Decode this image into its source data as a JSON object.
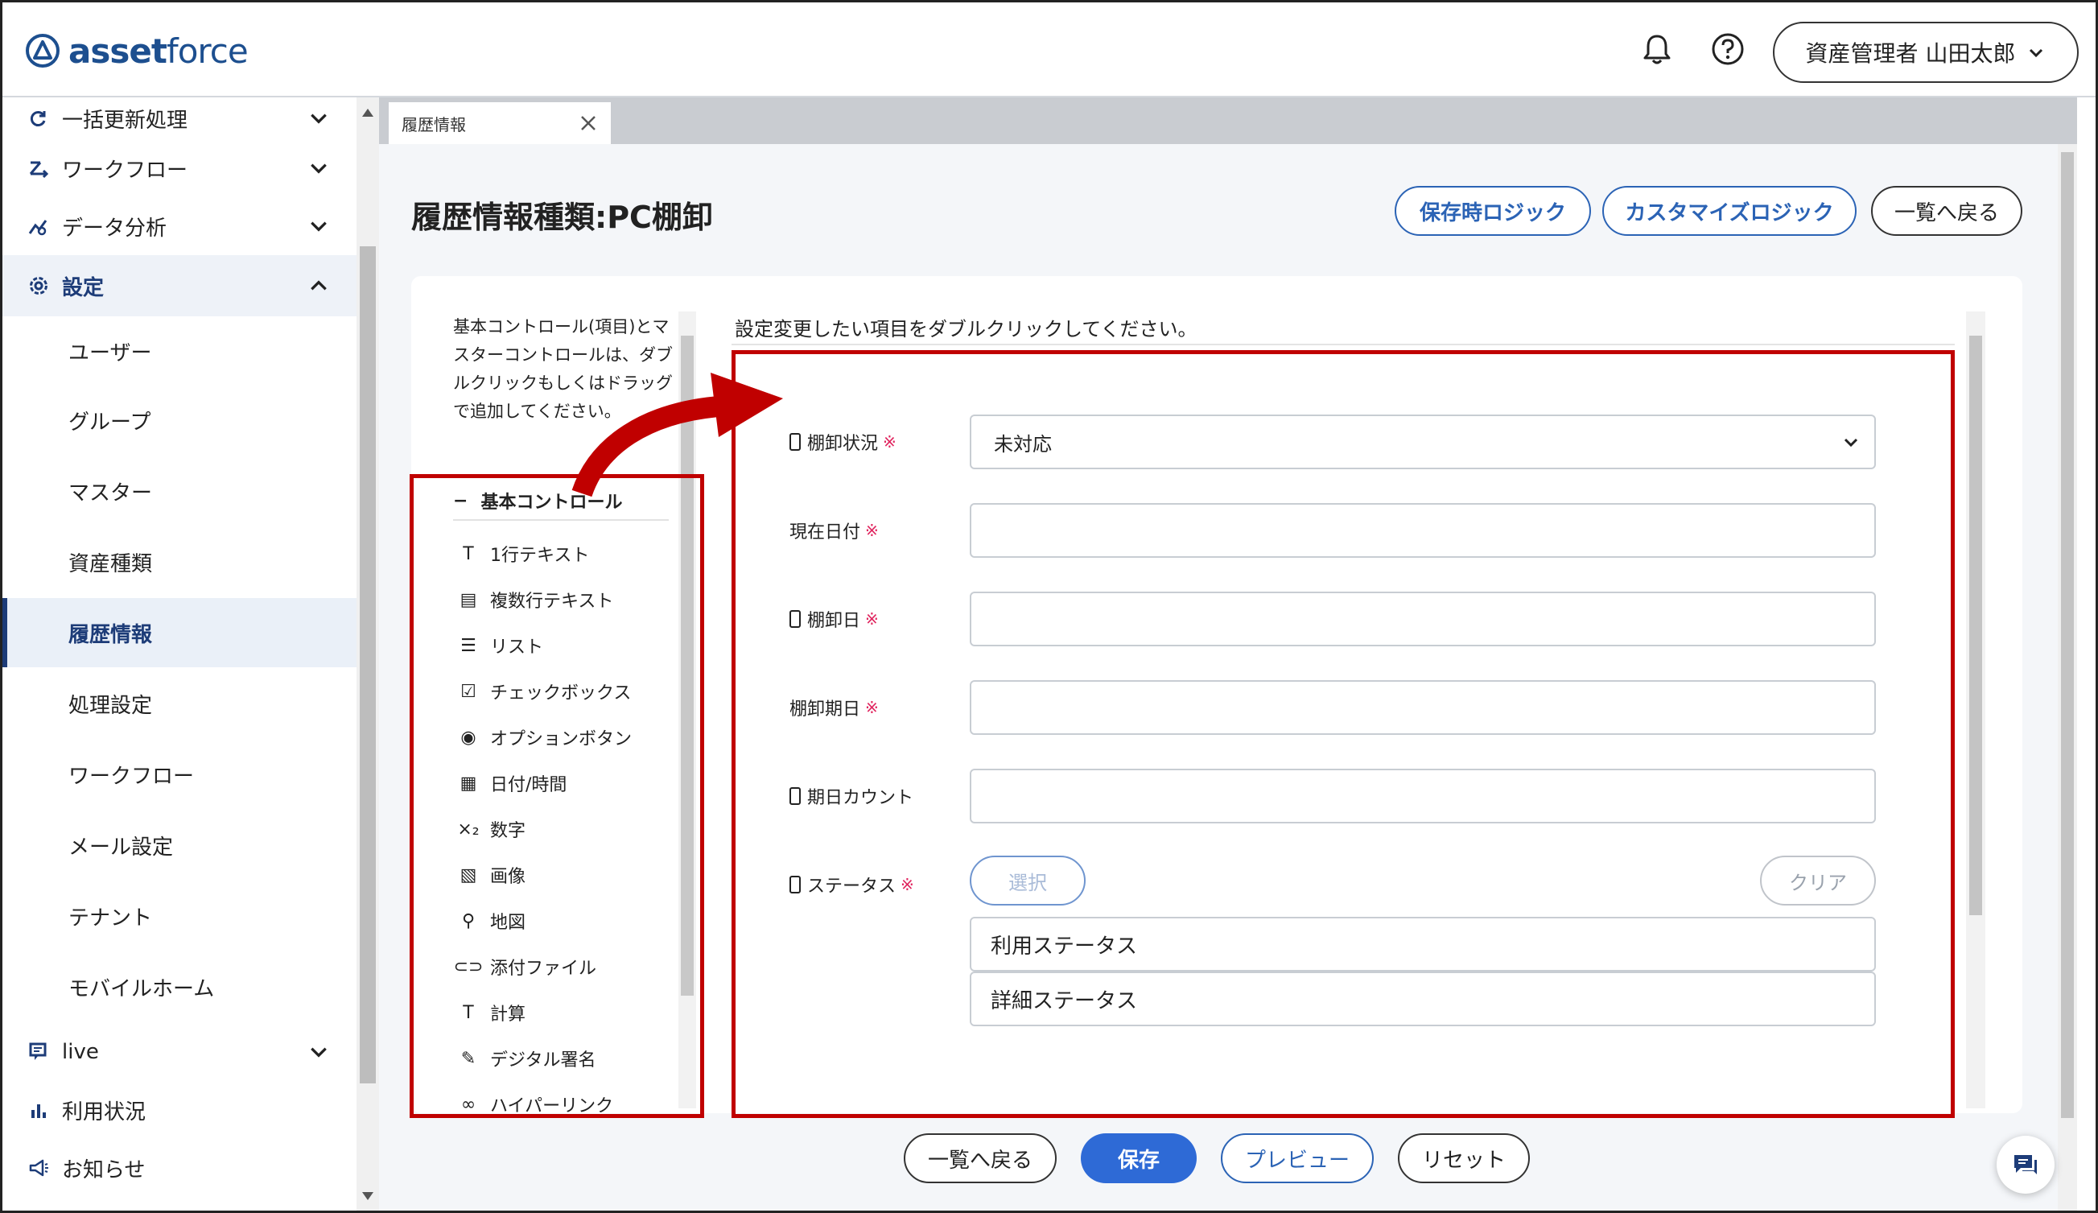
{
  "header": {
    "logo_bold": "asset",
    "logo_thin": "force",
    "user_label": "資産管理者 山田太郎",
    "icons": [
      "bell-icon",
      "help-icon"
    ]
  },
  "sidebar": {
    "items_top": [
      {
        "label": "一括更新処理",
        "icon": "refresh-icon"
      },
      {
        "label": "ワークフロー",
        "icon": "workflow-icon"
      },
      {
        "label": "データ分析",
        "icon": "analytics-icon"
      },
      {
        "label": "設定",
        "icon": "gear-icon"
      }
    ],
    "sub_items": [
      "ユーザー",
      "グループ",
      "マスター",
      "資産種類",
      "履歴情報",
      "処理設定",
      "ワークフロー",
      "メール設定",
      "テナント",
      "モバイルホーム"
    ],
    "active_sub": "履歴情報",
    "items_bottom": [
      {
        "label": "live",
        "icon": "live-icon"
      },
      {
        "label": "利用状況",
        "icon": "bar-chart-icon"
      },
      {
        "label": "お知らせ",
        "icon": "megaphone-icon"
      }
    ]
  },
  "tab": {
    "label": "履歴情報"
  },
  "page": {
    "title": "履歴情報種類:PC棚卸",
    "btn_save_logic": "保存時ロジック",
    "btn_custom_logic": "カスタマイズロジック",
    "btn_back_list": "一覧へ戻る"
  },
  "palette": {
    "intro": "基本コントロール(項目)とマスターコントロールは、ダブルクリックもしくはドラッグで追加してください。",
    "section_title": "基本コントロール",
    "section_toggle": "−",
    "items": [
      {
        "label": "1行テキスト",
        "icon": "T"
      },
      {
        "label": "複数行テキスト",
        "icon": "▤"
      },
      {
        "label": "リスト",
        "icon": "☰"
      },
      {
        "label": "チェックボックス",
        "icon": "☑"
      },
      {
        "label": "オプションボタン",
        "icon": "◉"
      },
      {
        "label": "日付/時間",
        "icon": "▦"
      },
      {
        "label": "数字",
        "icon": "×₂"
      },
      {
        "label": "画像",
        "icon": "▧"
      },
      {
        "label": "地図",
        "icon": "⚲"
      },
      {
        "label": "添付ファイル",
        "icon": "⊂⊃"
      },
      {
        "label": "計算",
        "icon": "T"
      },
      {
        "label": "デジタル署名",
        "icon": "✎"
      },
      {
        "label": "ハイパーリンク",
        "icon": "∞"
      }
    ]
  },
  "form": {
    "hint": "設定変更したい項目をダブルクリックしてください。",
    "required_mark": "※",
    "fields": [
      {
        "label": "棚卸状況",
        "mobile": true,
        "required": true,
        "type": "select",
        "value": "未対応"
      },
      {
        "label": "現在日付",
        "mobile": false,
        "required": true,
        "type": "text",
        "value": ""
      },
      {
        "label": "棚卸日",
        "mobile": true,
        "required": true,
        "type": "text",
        "value": ""
      },
      {
        "label": "棚卸期日",
        "mobile": false,
        "required": true,
        "type": "text",
        "value": ""
      },
      {
        "label": "期日カウント",
        "mobile": true,
        "required": false,
        "type": "text",
        "value": ""
      },
      {
        "label": "ステータス",
        "mobile": true,
        "required": true,
        "type": "multi"
      }
    ],
    "status_select_btn": "選択",
    "status_clear_btn": "クリア",
    "status_rows": [
      "利用ステータス",
      "詳細ステータス"
    ]
  },
  "footer": {
    "back": "一覧へ戻る",
    "save": "保存",
    "preview": "プレビュー",
    "reset": "リセット"
  },
  "colors": {
    "brand": "#1d4f8f",
    "primary": "#2e6ad6",
    "highlight_box": "#c00000",
    "required": "#e0245e"
  }
}
